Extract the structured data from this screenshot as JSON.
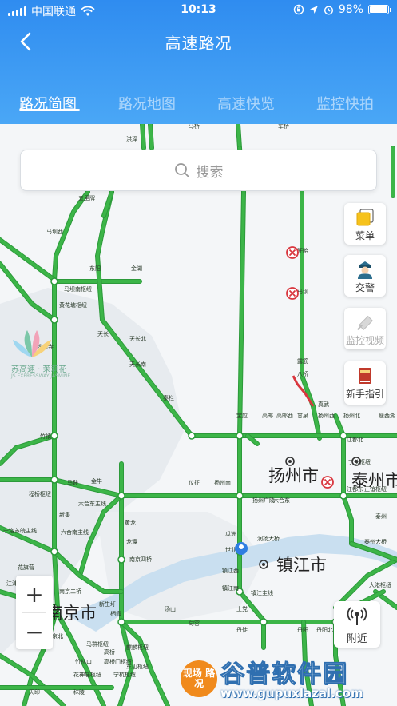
{
  "status_bar": {
    "carrier": "中国联通",
    "time": "10:13",
    "battery": "98%",
    "battery_level": 0.98
  },
  "nav": {
    "title": "高速路况",
    "back_icon": "chevron-left-icon"
  },
  "tabs": [
    {
      "label": "路况简图",
      "active": true
    },
    {
      "label": "路况地图",
      "active": false
    },
    {
      "label": "高速快览",
      "active": false
    },
    {
      "label": "监控快拍",
      "active": false
    }
  ],
  "search": {
    "placeholder": "搜索"
  },
  "tools": {
    "menu": "菜单",
    "police": "交警",
    "monitor_video": "监控视频",
    "guide": "新手指引",
    "nearby": "附近"
  },
  "zoom": {
    "in": "+",
    "out": "−"
  },
  "logo": {
    "brand": "苏高速 · 茉莉花",
    "brand_en": "JS EXPRESSWAY JASMINE"
  },
  "badge": {
    "live": "现场 路况"
  },
  "watermark": {
    "cn": "谷普软件园",
    "url": "www.gupuxlazal.com"
  },
  "map": {
    "colors": {
      "road": "#3cb548",
      "road_dark": "#2c9a3a",
      "congested": "#d9363e",
      "water": "#c9dff0",
      "land_shade": "#e6eaee",
      "background": "#f4f6f8"
    },
    "cities": [
      "扬州市",
      "镇江市",
      "泰州市",
      "南京市"
    ],
    "labels": [
      "马桥",
      "车桥",
      "洪泽",
      "五里牌",
      "马坝西",
      "盱眙",
      "马坝",
      "东阳",
      "金湖",
      "马坝南枢纽",
      "黄花塘枢纽",
      "天长",
      "天长北",
      "铁山寺",
      "天长南",
      "秦栏",
      "竹镇",
      "露筋",
      "八桥",
      "真武",
      "宝应",
      "高邮",
      "高邮西",
      "甘泉",
      "扬州西",
      "扬州北",
      "瘦西湖",
      "江都北",
      "丁伙枢纽",
      "江都东",
      "正谊枢纽",
      "泰州",
      "马鞍",
      "金牛",
      "新集",
      "程桥枢纽",
      "仪征",
      "扬州南",
      "扬州广陵",
      "六合东",
      "六合东主线",
      "宁洛苏皖主线",
      "六合南主线",
      "南京四桥",
      "润扬大桥",
      "瓜洲",
      "世业洲",
      "镇江西",
      "镇江主线",
      "镇江南",
      "丹阳北",
      "丹阳",
      "南京二桥",
      "花旗营",
      "江浦",
      "南京北",
      "新生圩",
      "栖霞",
      "龙潭",
      "汤山",
      "句容",
      "高桥",
      "麒麟枢纽",
      "宁杭枢纽",
      "东山枢纽",
      "花神庙枢纽",
      "马群枢纽",
      "天印",
      "秣陵",
      "泰州大桥",
      "大港枢纽",
      "高桥门枢纽",
      "竹林口",
      "上党",
      "丹徒",
      "黄龙"
    ],
    "incident_icon": "closed-road-icon",
    "location_icon": "location-pin-icon"
  }
}
